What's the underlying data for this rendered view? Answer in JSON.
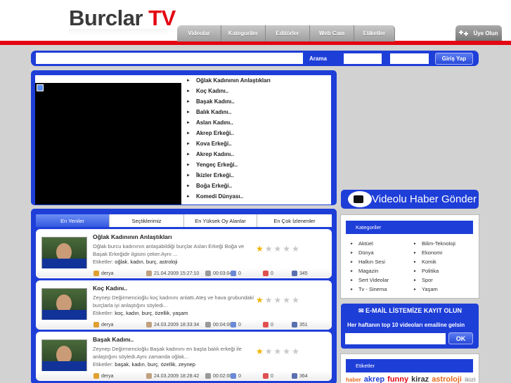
{
  "logo": {
    "part1": "Burclar",
    "part2": "TV"
  },
  "nav": {
    "items": [
      "Videolar",
      "Kategoriler",
      "Editörler",
      "Web Cam",
      "Etiketler"
    ],
    "uye_label": "Üye Olun"
  },
  "search": {
    "label": "Arama",
    "button": "Giriş Yap"
  },
  "playlist": [
    "Oğlak Kadınının Anlaştıkları",
    "Koç Kadını..",
    "Başak Kadını..",
    "Balık Kadını..",
    "Aslan Kadını..",
    "Akrep Erkeği..",
    "Kova Erkeği..",
    "Akrep Kadını..",
    "Yengeç Erkeği..",
    "İkizler Erkeği..",
    "Boğa Erkeği..",
    "Komedi Dünyası.."
  ],
  "tabs": [
    "En Yeniler",
    "Seçtiklerimiz",
    "En Yüksek Oy Alanlar",
    "En Çok İzlenenler"
  ],
  "videos": [
    {
      "title": "Oğlak Kadınının Anlaştıkları",
      "desc": "Oğlak burcu kadınının anlaşabildiği burçlar Aslan Erkeği Boğa ve Başak Erkeğidir ilgisini çeker.Aynı ...",
      "tags_label": "Etiketler:",
      "tags": [
        "oğlak",
        "kadın",
        "burç",
        "astroloji"
      ],
      "user": "derya",
      "date": "21.04.2009 15:27:10",
      "duration": "00:03:04",
      "comments": "0",
      "favs": "0",
      "views": "345",
      "rating": 0.5
    },
    {
      "title": "Koç Kadını..",
      "desc": "Zeynep Değirmencioğlu koç kadınını anlattı.Ateş ve hava grubundaki burçlarla iyi anlaştığını söyledi...",
      "tags_label": "Etiketler:",
      "tags": [
        "koç",
        "kadın",
        "burç",
        "özellik",
        "yaşam"
      ],
      "user": "derya",
      "date": "24.03.2009 18:33:34",
      "duration": "00:04:00",
      "comments": "0",
      "favs": "0",
      "views": "351",
      "rating": 0.5
    },
    {
      "title": "Başak Kadını..",
      "desc": "Zeynep Değirmencioğlu Başak kadınını en başta balık erkeği ile anlaştığını söyledi.Aynı zamanda oğlak...",
      "tags_label": "Etiketler:",
      "tags": [
        "başak",
        "kadın",
        "burç",
        "özellik",
        "zeynep"
      ],
      "user": "derya",
      "date": "24.03.2009 18:28:42",
      "duration": "00:02:00",
      "comments": "0",
      "favs": "0",
      "views": "364",
      "rating": 0.5
    }
  ],
  "videolu_haber": "Videolu Haber Gönder",
  "categories": {
    "title": "Kategoriler",
    "col1": [
      "Aktüel",
      "Dünya",
      "Halkın Sesi",
      "Magazin",
      "Sert Videolar",
      "Tv - Sinema"
    ],
    "col2": [
      "Bilim-Teknoloji",
      "Ekonomi",
      "Komik",
      "Politika",
      "Spor",
      "Yaşam"
    ]
  },
  "email": {
    "title": "E-MAİL LİSTEMİZE KAYIT OLUN",
    "subtitle": "Her haftanın top 10 videoları emailine gelsin",
    "button": "OK"
  },
  "tagcloud": {
    "title": "Etiketler",
    "tags": [
      {
        "t": "haber",
        "c": "#e56b1f"
      },
      {
        "t": "akrep",
        "c": "#1e3ed8"
      },
      {
        "t": "funny",
        "c": "#e30613"
      },
      {
        "t": "kiraz",
        "c": "#333333"
      },
      {
        "t": "astroloji",
        "c": "#e56b1f"
      },
      {
        "t": "ikizler",
        "c": "#999999"
      }
    ]
  },
  "colors": {
    "brand_blue": "#1e3ed8",
    "brand_red": "#e30613"
  }
}
